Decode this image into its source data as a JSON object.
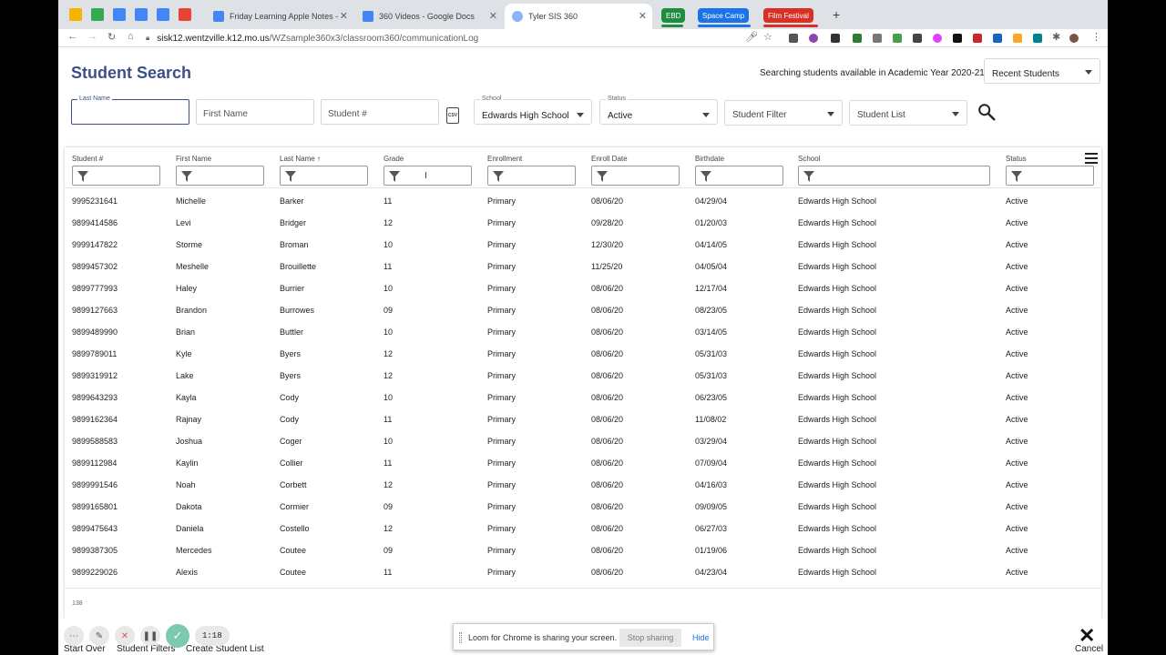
{
  "browser": {
    "tabs": [
      {
        "title": "Friday Learning Apple Notes -",
        "active": false
      },
      {
        "title": "360 Videos - Google Docs",
        "active": false
      },
      {
        "title": "Tyler SIS 360",
        "active": true
      }
    ],
    "groups": [
      {
        "label": "EBD",
        "color": "#1e8e3e"
      },
      {
        "label": "Space Camp",
        "color": "#1a73e8"
      },
      {
        "label": "Film Festival",
        "color": "#d93025"
      }
    ],
    "url_host": "sisk12.wentzville.k12.mo.us",
    "url_path": "/WZsample360x3/classroom360/communicationLog"
  },
  "header": {
    "title": "Student Search",
    "year_text": "Searching students available in Academic Year 2020-21",
    "recent_select": "Recent Students"
  },
  "search": {
    "last_name_label": "Last Name",
    "last_name_value": "",
    "first_name_placeholder": "First Name",
    "student_number_placeholder": "Student #",
    "school_label": "School",
    "school_value": "Edwards High School",
    "status_label": "Status",
    "status_value": "Active",
    "student_filter": "Student Filter",
    "student_list": "Student List",
    "csv_label": "CSV"
  },
  "grid": {
    "columns": [
      "Student #",
      "First Name",
      "Last Name",
      "Grade",
      "Enrollment",
      "Enroll Date",
      "Birthdate",
      "School",
      "Status"
    ],
    "sort_indicator": "↑",
    "rows": [
      [
        "9995231641",
        "Michelle",
        "Barker",
        "11",
        "Primary",
        "08/06/20",
        "04/29/04",
        "Edwards High School",
        "Active"
      ],
      [
        "9899414586",
        "Levi",
        "Bridger",
        "12",
        "Primary",
        "09/28/20",
        "01/20/03",
        "Edwards High School",
        "Active"
      ],
      [
        "9999147822",
        "Storme",
        "Broman",
        "10",
        "Primary",
        "12/30/20",
        "04/14/05",
        "Edwards High School",
        "Active"
      ],
      [
        "9899457302",
        "Meshelle",
        "Brouillette",
        "11",
        "Primary",
        "11/25/20",
        "04/05/04",
        "Edwards High School",
        "Active"
      ],
      [
        "9899777993",
        "Haley",
        "Burrier",
        "10",
        "Primary",
        "08/06/20",
        "12/17/04",
        "Edwards High School",
        "Active"
      ],
      [
        "9899127663",
        "Brandon",
        "Burrowes",
        "09",
        "Primary",
        "08/06/20",
        "08/23/05",
        "Edwards High School",
        "Active"
      ],
      [
        "9899489990",
        "Brian",
        "Buttler",
        "10",
        "Primary",
        "08/06/20",
        "03/14/05",
        "Edwards High School",
        "Active"
      ],
      [
        "9899789011",
        "Kyle",
        "Byers",
        "12",
        "Primary",
        "08/06/20",
        "05/31/03",
        "Edwards High School",
        "Active"
      ],
      [
        "9899319912",
        "Lake",
        "Byers",
        "12",
        "Primary",
        "08/06/20",
        "05/31/03",
        "Edwards High School",
        "Active"
      ],
      [
        "9899643293",
        "Kayla",
        "Cody",
        "10",
        "Primary",
        "08/06/20",
        "06/23/05",
        "Edwards High School",
        "Active"
      ],
      [
        "9899162364",
        "Rajnay",
        "Cody",
        "11",
        "Primary",
        "08/06/20",
        "11/08/02",
        "Edwards High School",
        "Active"
      ],
      [
        "9899588583",
        "Joshua",
        "Coger",
        "10",
        "Primary",
        "08/06/20",
        "03/29/04",
        "Edwards High School",
        "Active"
      ],
      [
        "9899112984",
        "Kaylin",
        "Collier",
        "11",
        "Primary",
        "08/06/20",
        "07/09/04",
        "Edwards High School",
        "Active"
      ],
      [
        "9899991546",
        "Noah",
        "Corbett",
        "12",
        "Primary",
        "08/06/20",
        "04/16/03",
        "Edwards High School",
        "Active"
      ],
      [
        "9899165801",
        "Dakota",
        "Cormier",
        "09",
        "Primary",
        "08/06/20",
        "09/09/05",
        "Edwards High School",
        "Active"
      ],
      [
        "9899475643",
        "Daniela",
        "Costello",
        "12",
        "Primary",
        "08/06/20",
        "06/27/03",
        "Edwards High School",
        "Active"
      ],
      [
        "9899387305",
        "Mercedes",
        "Coutee",
        "09",
        "Primary",
        "08/06/20",
        "01/19/06",
        "Edwards High School",
        "Active"
      ],
      [
        "9899229026",
        "Alexis",
        "Coutee",
        "11",
        "Primary",
        "08/06/20",
        "04/23/04",
        "Edwards High School",
        "Active"
      ]
    ],
    "count": "138"
  },
  "bottom": {
    "start_over": "Start Over",
    "student_filters": "Student Filters",
    "create_student_list": "Create Student List",
    "cancel": "Cancel"
  },
  "recorder": {
    "time": "1:18"
  },
  "sharebar": {
    "message": "Loom for Chrome is sharing your screen.",
    "stop": "Stop sharing",
    "hide": "Hide"
  }
}
